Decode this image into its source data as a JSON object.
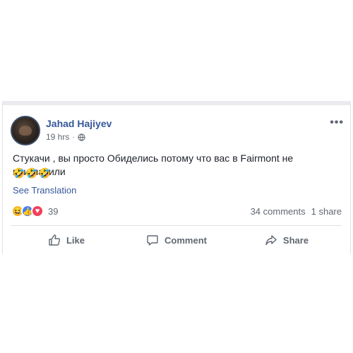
{
  "post": {
    "author": "Jahad Hajiyev",
    "time": "19 hrs",
    "separator": "·",
    "text": "Стукачи , вы просто Обиделись потому что вас в Fairmont не пригласили",
    "emojis": "🤣🤣🤣",
    "see_translation": "See Translation",
    "reaction_count": "39",
    "comments": "34 comments",
    "shares": "1 share"
  },
  "actions": {
    "like": "Like",
    "comment": "Comment",
    "share": "Share"
  },
  "icons": {
    "more": "•••",
    "haha": "😆",
    "like": "👍",
    "love": "♥"
  }
}
